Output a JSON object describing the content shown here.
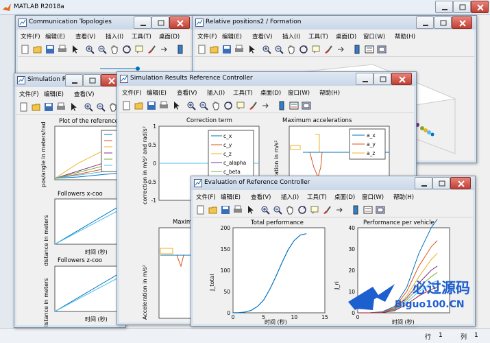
{
  "app": {
    "title": "MATLAB R2018a",
    "status": {
      "row_label": "行",
      "row_value": "1",
      "col_label": "列",
      "col_value": "1"
    }
  },
  "menu": {
    "file": "文件(F)",
    "edit": "编辑(E)",
    "view": "查看(V)",
    "insert": "插入(I)",
    "tools": "工具(T)",
    "desktop": "桌面(D)",
    "window": "窗口(W)",
    "help": "帮助(H)"
  },
  "windows": {
    "comm": {
      "title": "Communication Topologies"
    },
    "relpos": {
      "title": "Relative positions2 / Formation"
    },
    "consensus": {
      "title": "Simulation Results Consensus"
    },
    "refctrl": {
      "title": "Simulation Results Reference Controller"
    },
    "evalctrl": {
      "title": "Evaluation of Reference Controller"
    }
  },
  "colors": {
    "blue": "#0072bd",
    "orange": "#d95319",
    "yellow": "#edb120",
    "purple": "#7e2f8e",
    "green": "#77ac30",
    "cyan": "#4dbeee",
    "red": "#a2142f"
  },
  "icons": [
    "new-icon",
    "open-icon",
    "save-icon",
    "print-icon",
    "pointer-icon",
    "zoom-in-icon",
    "zoom-out-icon",
    "pan-icon",
    "rotate-icon",
    "datatip-icon",
    "brush-icon",
    "link-icon",
    "colorbar-icon",
    "legend-icon",
    "plottools-icon"
  ],
  "chart_data": [
    {
      "type": "line",
      "window": "consensus",
      "title": "Plot of the reference",
      "xlabel": "",
      "ylabel": "pos/angle in meters/rad",
      "series_colors": [
        "blue",
        "orange",
        "yellow",
        "purple",
        "green",
        "cyan"
      ]
    },
    {
      "type": "line",
      "window": "consensus",
      "title": "Followers x-coo",
      "xlabel": "时间 (秒)",
      "ylabel": "distance in meters"
    },
    {
      "type": "line",
      "window": "consensus",
      "title": "Followers z-coo",
      "xlabel": "时间 (秒)",
      "ylabel": "distance in meters"
    },
    {
      "type": "line",
      "window": "refctrl",
      "title": "Correction term",
      "xlabel": "",
      "ylabel": "correction in m/s² and rad/s²",
      "ylim": [
        -1,
        1
      ],
      "yticks": [
        "1",
        "0.5",
        "0",
        "-0.5",
        "-1"
      ],
      "legend": [
        "c_x",
        "c_y",
        "c_z",
        "c_alapha",
        "c_beta"
      ],
      "legend_placement": "top-right"
    },
    {
      "type": "line",
      "window": "refctrl",
      "title": "Maximum accelerations",
      "xlabel": "",
      "ylabel": "acceleration in m/s²",
      "legend": [
        "a_x",
        "a_y",
        "a_z"
      ],
      "legend_placement": "top-right"
    },
    {
      "type": "line",
      "window": "refctrl",
      "title": "Maximu",
      "xlabel": "",
      "ylabel": "Acceleration in m/s²"
    },
    {
      "type": "line",
      "window": "evalctrl",
      "title": "Total performance",
      "xlabel": "时间 (秒)",
      "ylabel": "J_total",
      "x": [
        0,
        1,
        2,
        3,
        4,
        5,
        6,
        7,
        8,
        9,
        10,
        11,
        12
      ],
      "values": [
        0,
        0.5,
        2,
        6,
        15,
        30,
        55,
        85,
        118,
        148,
        170,
        183,
        186
      ],
      "xlim": [
        0,
        15
      ],
      "ylim": [
        0,
        200
      ],
      "xticks": [
        "0",
        "5",
        "10",
        "15"
      ],
      "yticks": [
        "200",
        "150",
        "100",
        "50",
        "0"
      ]
    },
    {
      "type": "line",
      "window": "evalctrl",
      "title": "Performance per vehicle",
      "xlabel": "时间 (秒)",
      "ylabel": "J_ri",
      "xlim": [
        0,
        15
      ],
      "ylim": [
        0,
        40
      ],
      "xticks": [
        "0"
      ],
      "yticks": [
        "40",
        "30",
        "20",
        "10",
        "0"
      ],
      "series": [
        {
          "values": [
            0,
            0,
            0.5,
            3,
            12,
            28,
            40,
            44
          ]
        },
        {
          "values": [
            0,
            0,
            0.4,
            2.5,
            10,
            22,
            31,
            34
          ]
        },
        {
          "values": [
            0,
            0,
            0.3,
            2,
            8,
            17,
            25,
            28
          ]
        },
        {
          "values": [
            0,
            0,
            0.3,
            1.8,
            7,
            14,
            20,
            22
          ]
        },
        {
          "values": [
            0,
            0,
            0.2,
            1.5,
            6,
            12,
            17,
            19
          ]
        },
        {
          "values": [
            0,
            0,
            0.2,
            1.2,
            5,
            10,
            14,
            15
          ]
        },
        {
          "values": [
            0,
            0,
            0.1,
            1,
            4,
            8,
            11,
            12
          ]
        }
      ],
      "series_colors": [
        "blue",
        "orange",
        "yellow",
        "purple",
        "green",
        "cyan",
        "red"
      ],
      "x": [
        0,
        2,
        4,
        6,
        8,
        10,
        12,
        13
      ]
    }
  ],
  "watermark": {
    "text1": "必过源码",
    "text2": "Biguo100.CN"
  }
}
